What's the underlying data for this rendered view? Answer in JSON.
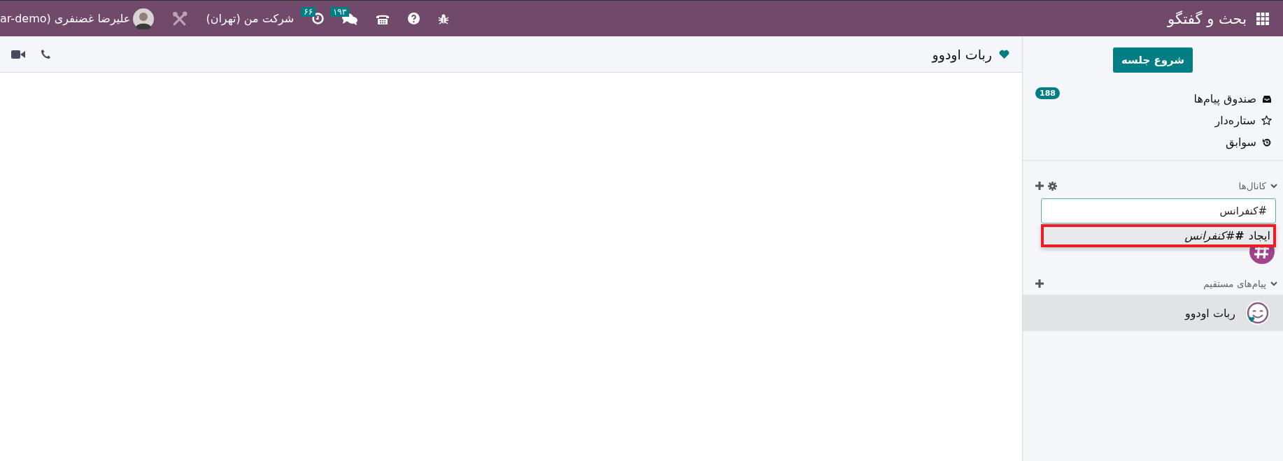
{
  "app_title": "بحث و گفتگو",
  "topbar": {
    "user_name": "علیرضا غضنفری (ar-demo",
    "company": "شرکت من (تهران)",
    "activity_count": "۶۶",
    "message_count": "۱۹۳"
  },
  "sidebar": {
    "start_button": "شروع جلسه",
    "mailboxes": [
      {
        "kind": "inbox",
        "label": "صندوق پیام‌ها",
        "badge": "188"
      },
      {
        "kind": "starred",
        "label": "ستاره‌دار"
      },
      {
        "kind": "history",
        "label": "سوابق"
      }
    ],
    "channels": {
      "title": "کانال‌ها",
      "expanded": true,
      "search_value": "#کنفرانس",
      "suggestion": {
        "action": "ایجاد",
        "mark": "#",
        "name": "#کنفرانس",
        "highlighted": true
      }
    },
    "direct": {
      "title": "پیام‌های مستقیم",
      "expanded": true,
      "items": [
        {
          "name": "ربات اودوو",
          "selected": true
        }
      ]
    }
  },
  "chat": {
    "title": "ربات اودوو"
  }
}
